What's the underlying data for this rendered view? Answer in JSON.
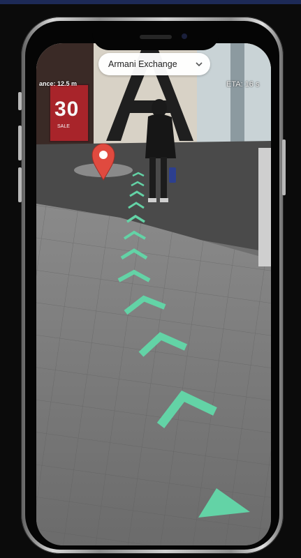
{
  "destination": {
    "selected": "Armani Exchange",
    "icon": "chevron-down-icon"
  },
  "hud": {
    "distance_text": "ance: 12.5 m",
    "eta_text": "ETA: 16 s"
  },
  "sign": {
    "big_text": "30",
    "small_text": "SALE"
  },
  "colors": {
    "path_arrow": "#63d3a6",
    "pin": "#e04a3f",
    "pill_bg": "#ffffff",
    "floor": "#7a7a7a"
  }
}
